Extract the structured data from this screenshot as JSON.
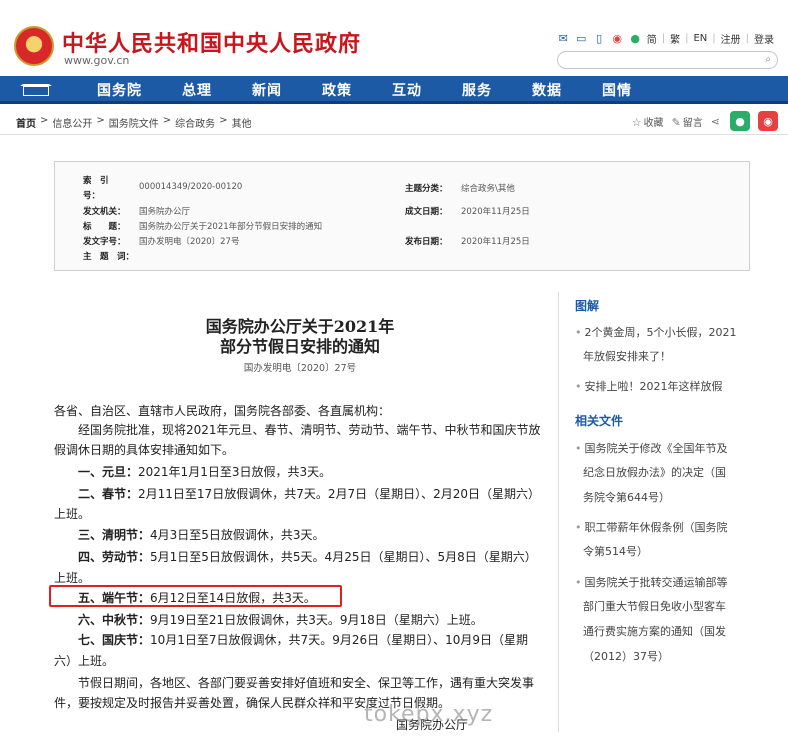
{
  "header": {
    "title": "中华人民共和国中央人民政府",
    "url": "www.gov.cn",
    "links": [
      "简",
      "繁",
      "EN",
      "注册",
      "登录"
    ],
    "search_placeholder": ""
  },
  "nav": [
    "国务院",
    "总理",
    "新闻",
    "政策",
    "互动",
    "服务",
    "数据",
    "国情"
  ],
  "breadcrumb": [
    "首页",
    ">",
    "信息公开",
    ">",
    "国务院文件",
    ">",
    "综合政务",
    ">",
    "其他"
  ],
  "tools": {
    "favorite": "收藏",
    "comment": "留言"
  },
  "info": {
    "index_label_a": "索　引",
    "index_label_b": "号：",
    "index_value": "000014349/2020-00120",
    "subject_label": "主题分类：",
    "subject_value": "综合政务\\其他",
    "issuer_label": "发文机关：",
    "issuer_value": "国务院办公厅",
    "date_written_label": "成文日期：",
    "date_written_value": "2020年11月25日",
    "title_label": "标　　题：",
    "title_value": "国务院办公厅关于2021年部分节假日安排的通知",
    "docno_label": "发文字号：",
    "docno_value": "国办发明电〔2020〕27号",
    "publish_label": "发布日期：",
    "publish_value": "2020年11月25日",
    "keywords_label": "主　题　词："
  },
  "article": {
    "title_line1": "国务院办公厅关于2021年",
    "title_line2": "部分节假日安排的通知",
    "docno": "国办发明电〔2020〕27号",
    "salutation": "各省、自治区、直辖市人民政府，国务院各部委、各直属机构：",
    "intro1": "经国务院批准，现将2021年元旦、春节、清明节、劳动节、端午节、中秋节和国庆节放",
    "intro2": "假调休日期的具体安排通知如下。",
    "items": [
      {
        "label": "一、元旦：",
        "text": "2021年1月1日至3日放假，共3天。"
      },
      {
        "label": "二、春节：",
        "text": "2月11日至17日放假调休，共7天。2月7日（星期日）、2月20日（星期六）"
      },
      {
        "label": "",
        "text": "上班。"
      },
      {
        "label": "三、清明节：",
        "text": "4月3日至5日放假调休，共3天。"
      },
      {
        "label": "四、劳动节：",
        "text": "5月1日至5日放假调休，共5天。4月25日（星期日）、5月8日（星期六）"
      },
      {
        "label": "",
        "text": "上班。"
      },
      {
        "label": "五、端午节：",
        "text": "6月12日至14日放假，共3天。"
      },
      {
        "label": "六、中秋节：",
        "text": "9月19日至21日放假调休，共3天。9月18日（星期六）上班。"
      },
      {
        "label": "七、国庆节：",
        "text": "10月1日至7日放假调休，共7天。9月26日（星期日）、10月9日（星期"
      },
      {
        "label": "",
        "text": "六）上班。"
      }
    ],
    "closing1": "节假日期间，各地区、各部门要妥善安排好值班和安全、保卫等工作，遇有重大突发事",
    "closing2": "件，要按规定及时报告并妥善处置，确保人民群众祥和平安度过节日假期。",
    "signature": "国务院办公厅"
  },
  "sidebar": {
    "section1_title": "图解",
    "section1_lines": [
      "2个黄金周，5个小长假，2021",
      "年放假安排来了！",
      "安排上啦！2021年这样放假"
    ],
    "section2_title": "相关文件",
    "section2_lines": [
      "国务院关于修改《全国年节及",
      "纪念日放假办法》的决定（国",
      "务院令第644号）",
      "职工带薪年休假条例（国务院",
      "令第514号）",
      "国务院关于批转交通运输部等",
      "部门重大节假日免收小型客车",
      "通行费实施方案的通知（国发",
      "（2012）37号）"
    ]
  },
  "watermark": "tokepx.xyz"
}
